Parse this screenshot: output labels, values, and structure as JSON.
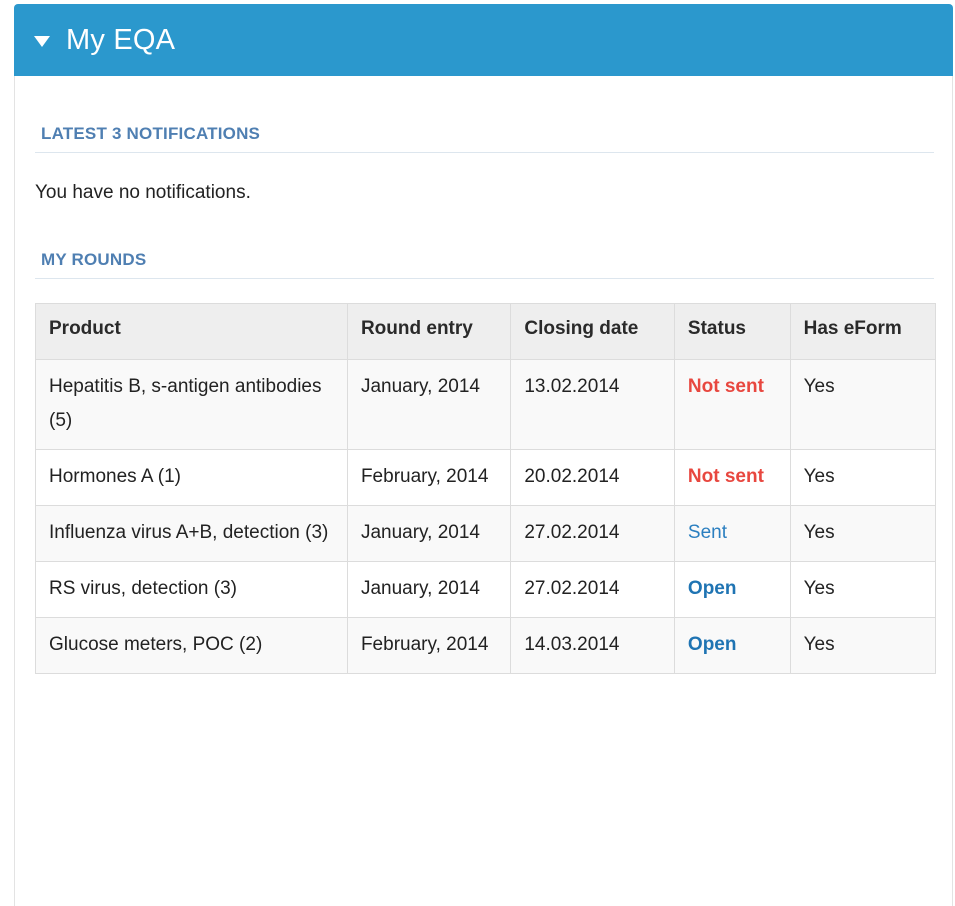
{
  "panel": {
    "title": "My EQA"
  },
  "notifications": {
    "heading": "LATEST 3 NOTIFICATIONS",
    "empty_text": "You have no notifications."
  },
  "rounds": {
    "heading": "MY ROUNDS",
    "columns": [
      "Product",
      "Round entry",
      "Closing date",
      "Status",
      "Has eForm"
    ],
    "rows": [
      {
        "product": "Hepatitis B, s-antigen antibodies (5)",
        "round_entry": "January, 2014",
        "closing_date": "13.02.2014",
        "status": "Not sent",
        "status_kind": "notsent",
        "has_eform": "Yes"
      },
      {
        "product": "Hormones A (1)",
        "round_entry": "February, 2014",
        "closing_date": "20.02.2014",
        "status": "Not sent",
        "status_kind": "notsent",
        "has_eform": "Yes"
      },
      {
        "product": "Influenza virus A+B, detection (3)",
        "round_entry": "January, 2014",
        "closing_date": "27.02.2014",
        "status": "Sent",
        "status_kind": "sent",
        "has_eform": "Yes"
      },
      {
        "product": "RS virus, detection (3)",
        "round_entry": "January, 2014",
        "closing_date": "27.02.2014",
        "status": "Open",
        "status_kind": "open",
        "has_eform": "Yes"
      },
      {
        "product": "Glucose meters, POC (2)",
        "round_entry": "February, 2014",
        "closing_date": "14.03.2014",
        "status": "Open",
        "status_kind": "open",
        "has_eform": "Yes"
      }
    ]
  },
  "colors": {
    "header_bg": "#2b98cd",
    "section_title": "#4f7fb2",
    "status_not_sent": "#e8473f",
    "status_sent": "#2b7fc0",
    "status_open": "#1f74b3"
  },
  "icons": {
    "header_toggle": "caret-down-icon"
  }
}
